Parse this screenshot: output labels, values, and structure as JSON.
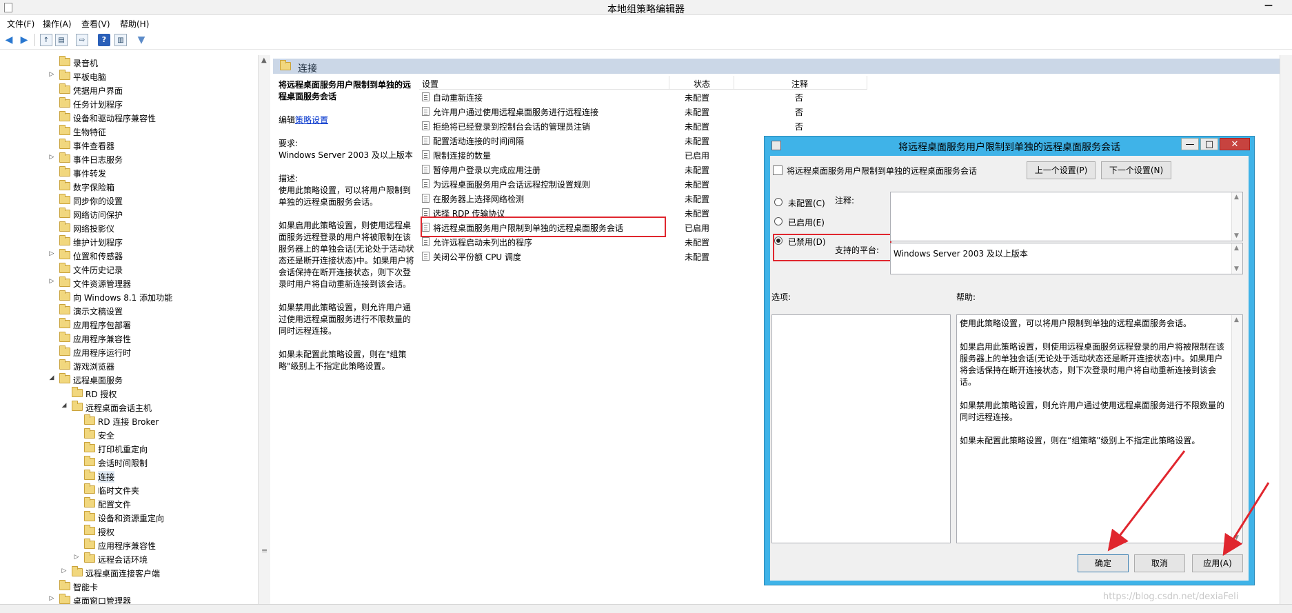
{
  "window": {
    "title": "本地组策略编辑器"
  },
  "menu": [
    "文件(F)",
    "操作(A)",
    "查看(V)",
    "帮助(H)"
  ],
  "tree": {
    "items": [
      {
        "label": "录音机",
        "expander": ""
      },
      {
        "label": "平板电脑",
        "expander": "▷"
      },
      {
        "label": "凭据用户界面",
        "expander": ""
      },
      {
        "label": "任务计划程序",
        "expander": ""
      },
      {
        "label": "设备和驱动程序兼容性",
        "expander": ""
      },
      {
        "label": "生物特征",
        "expander": ""
      },
      {
        "label": "事件查看器",
        "expander": ""
      },
      {
        "label": "事件日志服务",
        "expander": "▷"
      },
      {
        "label": "事件转发",
        "expander": ""
      },
      {
        "label": "数字保险箱",
        "expander": ""
      },
      {
        "label": "同步你的设置",
        "expander": ""
      },
      {
        "label": "网络访问保护",
        "expander": ""
      },
      {
        "label": "网络投影仪",
        "expander": ""
      },
      {
        "label": "维护计划程序",
        "expander": ""
      },
      {
        "label": "位置和传感器",
        "expander": "▷"
      },
      {
        "label": "文件历史记录",
        "expander": ""
      },
      {
        "label": "文件资源管理器",
        "expander": "▷"
      },
      {
        "label": "向 Windows 8.1 添加功能",
        "expander": ""
      },
      {
        "label": "演示文稿设置",
        "expander": ""
      },
      {
        "label": "应用程序包部署",
        "expander": ""
      },
      {
        "label": "应用程序兼容性",
        "expander": ""
      },
      {
        "label": "应用程序运行时",
        "expander": ""
      },
      {
        "label": "游戏浏览器",
        "expander": ""
      },
      {
        "label": "远程桌面服务",
        "expander": "◢"
      },
      {
        "label": "RD 授权",
        "expander": ""
      },
      {
        "label": "远程桌面会话主机",
        "expander": "◢"
      },
      {
        "label": "RD 连接 Broker",
        "expander": ""
      },
      {
        "label": "安全",
        "expander": ""
      },
      {
        "label": "打印机重定向",
        "expander": ""
      },
      {
        "label": "会话时间限制",
        "expander": ""
      },
      {
        "label": "连接",
        "expander": ""
      },
      {
        "label": "临时文件夹",
        "expander": ""
      },
      {
        "label": "配置文件",
        "expander": ""
      },
      {
        "label": "设备和资源重定向",
        "expander": ""
      },
      {
        "label": "授权",
        "expander": ""
      },
      {
        "label": "应用程序兼容性",
        "expander": ""
      },
      {
        "label": "远程会话环境",
        "expander": "▷"
      },
      {
        "label": "远程桌面连接客户端",
        "expander": "▷"
      },
      {
        "label": "智能卡",
        "expander": ""
      },
      {
        "label": "桌面窗口管理器",
        "expander": "▷"
      }
    ]
  },
  "content": {
    "header": "连接",
    "description": {
      "title": "将远程桌面服务用户限制到单独的远程桌面服务会话",
      "edit_prefix": "编辑",
      "edit_link": "策略设置",
      "req_label": "要求:",
      "req_value": "Windows Server 2003 及以上版本",
      "desc_label": "描述:",
      "desc_p1": "使用此策略设置，可以将用户限制到单独的远程桌面服务会话。",
      "desc_p2": "如果启用此策略设置，则使用远程桌面服务远程登录的用户将被限制在该服务器上的单独会话(无论处于活动状态还是断开连接状态)中。如果用户将会话保持在断开连接状态，则下次登录时用户将自动重新连接到该会话。",
      "desc_p3": "如果禁用此策略设置，则允许用户通过使用远程桌面服务进行不限数量的同时远程连接。",
      "desc_p4": "如果未配置此策略设置，则在\"组策略\"级别上不指定此策略设置。"
    },
    "columns": {
      "setting": "设置",
      "state": "状态",
      "comment": "注释"
    },
    "rows": [
      {
        "setting": "自动重新连接",
        "state": "未配置",
        "comment": "否"
      },
      {
        "setting": "允许用户通过使用远程桌面服务进行远程连接",
        "state": "未配置",
        "comment": "否"
      },
      {
        "setting": "拒绝将已经登录到控制台会话的管理员注销",
        "state": "未配置",
        "comment": "否"
      },
      {
        "setting": "配置活动连接的时间间隔",
        "state": "未配置",
        "comment": ""
      },
      {
        "setting": "限制连接的数量",
        "state": "已启用",
        "comment": ""
      },
      {
        "setting": "暂停用户登录以完成应用注册",
        "state": "未配置",
        "comment": ""
      },
      {
        "setting": "为远程桌面服务用户会话远程控制设置规则",
        "state": "未配置",
        "comment": ""
      },
      {
        "setting": "在服务器上选择网络检测",
        "state": "未配置",
        "comment": ""
      },
      {
        "setting": "选择 RDP 传输协议",
        "state": "未配置",
        "comment": ""
      },
      {
        "setting": "将远程桌面服务用户限制到单独的远程桌面服务会话",
        "state": "已启用",
        "comment": ""
      },
      {
        "setting": "允许远程启动未列出的程序",
        "state": "未配置",
        "comment": ""
      },
      {
        "setting": "关闭公平份额 CPU 调度",
        "state": "未配置",
        "comment": ""
      }
    ]
  },
  "dialog": {
    "title": "将远程桌面服务用户限制到单独的远程桌面服务会话",
    "subtitle": "将远程桌面服务用户限制到单独的远程桌面服务会话",
    "prev_button": "上一个设置(P)",
    "next_button": "下一个设置(N)",
    "radio_not_configured": "未配置(C)",
    "radio_enabled": "已启用(E)",
    "radio_disabled": "已禁用(D)",
    "selected_option": "已禁用(D)",
    "comment_label": "注释:",
    "comment_value": "",
    "platform_label": "支持的平台:",
    "platform_value": "Windows Server 2003 及以上版本",
    "options_label": "选项:",
    "help_label": "帮助:",
    "help_p1": "使用此策略设置，可以将用户限制到单独的远程桌面服务会话。",
    "help_p2": "如果启用此策略设置，则使用远程桌面服务远程登录的用户将被限制在该服务器上的单独会话(无论处于活动状态还是断开连接状态)中。如果用户将会话保持在断开连接状态，则下次登录时用户将自动重新连接到该会话。",
    "help_p3": "如果禁用此策略设置，则允许用户通过使用远程桌面服务进行不限数量的同时远程连接。",
    "help_p4": "如果未配置此策略设置，则在“组策略”级别上不指定此策略设置。",
    "ok_button": "确定",
    "cancel_button": "取消",
    "apply_button": "应用(A)",
    "min_glyph": "—",
    "max_glyph": "□",
    "close_glyph": "✕"
  },
  "watermark": "https://blog.csdn.net/dexiaFeli",
  "colors": {
    "highlight": "#e0262e",
    "dialog_frame": "#3fb3e8",
    "content_header": "#cbd7e7"
  }
}
